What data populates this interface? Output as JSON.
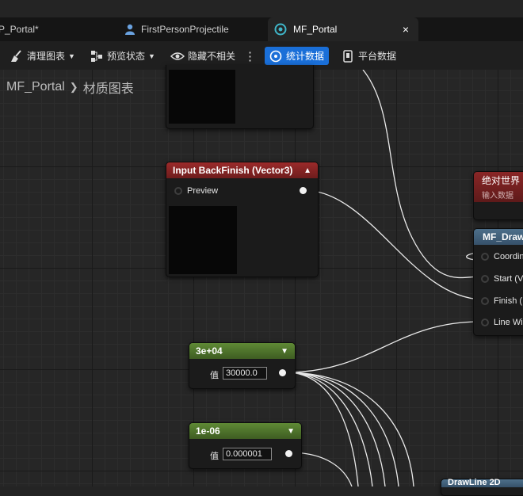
{
  "tabs": [
    {
      "label": "P_Portal*"
    },
    {
      "label": "FirstPersonProjectile"
    },
    {
      "label": "MF_Portal",
      "close": "×"
    }
  ],
  "toolbar": {
    "clean_graph": "清理图表",
    "preview_state": "预览状态",
    "hide_unrelated": "隐藏不相关",
    "more": "⋮",
    "stats": "统计数据",
    "platform_stats": "平台数据"
  },
  "breadcrumb": {
    "root": "MF_Portal",
    "separator": "❯",
    "current": "材质图表"
  },
  "nodes": {
    "backfinish": {
      "title": "Input BackFinish (Vector3)",
      "pin_label": "Preview"
    },
    "const_large": {
      "title": "3e+04",
      "value_label": "值",
      "value": "30000.0"
    },
    "const_small": {
      "title": "1e-06",
      "value_label": "值",
      "value": "0.000001"
    },
    "absolute_world": {
      "title": "绝对世界",
      "subtitle": "输入数据"
    },
    "mf_draw": {
      "title": "MF_Draw",
      "pins": [
        "Coordin",
        "Start (V",
        "Finish (",
        "Line Wi"
      ]
    },
    "drawline": {
      "title": "DrawLine 2D"
    }
  },
  "icons": {
    "broom": "broom-icon",
    "nodes": "nodes-icon",
    "eye": "eye-icon",
    "stats": "stats-icon",
    "platform": "platform-icon"
  },
  "colors": {
    "accent": "#1a6fd8",
    "input_header": "#8a2626",
    "constant_header": "#4e7a2c",
    "function_header": "#4d6f8a"
  }
}
